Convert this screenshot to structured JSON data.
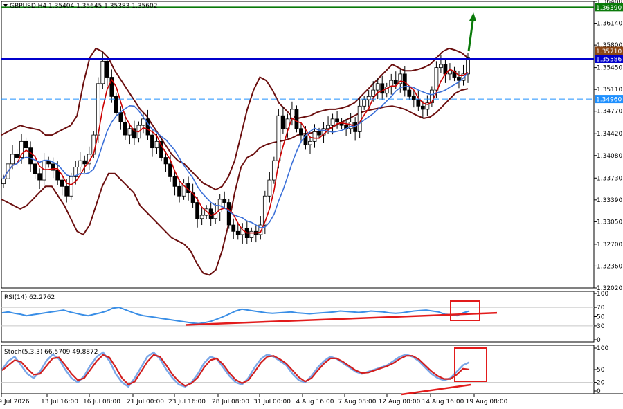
{
  "header": {
    "symbol": "GBPUSD,H4",
    "ohlc": "1.35404 1.35645 1.35383 1.35602"
  },
  "chart_data": [
    {
      "type": "candlestick",
      "name": "main",
      "ylim": [
        1.3202,
        1.3648
      ],
      "y_ticks": [
        "1.36480",
        "1.36140",
        "1.35800",
        "1.35450",
        "1.35110",
        "1.34770",
        "1.34420",
        "1.34080",
        "1.33730",
        "1.33390",
        "1.33050",
        "1.32700",
        "1.32360",
        "1.32020"
      ],
      "price_tags": [
        {
          "label": "1.36390",
          "value": 1.3639,
          "bg": "#0a7a0a",
          "fg": "#ffffff"
        },
        {
          "label": "1.35710",
          "value": 1.3571,
          "bg": "#8b4513",
          "fg": "#ffffff"
        },
        {
          "label": "1.35586",
          "value": 1.35586,
          "bg": "#0000cc",
          "fg": "#ffffff"
        },
        {
          "label": "1.34960",
          "value": 1.3496,
          "bg": "#1e90ff",
          "fg": "#ffffff"
        }
      ],
      "hlines": [
        {
          "value": 1.3639,
          "color": "#0a7a0a",
          "style": "solid",
          "width": 2
        },
        {
          "value": 1.3571,
          "color": "#8b4513",
          "style": "dashed",
          "width": 1
        },
        {
          "value": 1.35586,
          "color": "#0000cc",
          "style": "solid",
          "width": 2
        },
        {
          "value": 1.3496,
          "color": "#1e90ff",
          "style": "dashed",
          "width": 1
        }
      ],
      "closes": [
        1.3372,
        1.3395,
        1.341,
        1.3405,
        1.343,
        1.342,
        1.3395,
        1.338,
        1.337,
        1.34,
        1.3395,
        1.3385,
        1.337,
        1.336,
        1.3345,
        1.3375,
        1.339,
        1.34,
        1.3395,
        1.341,
        1.344,
        1.352,
        1.3555,
        1.353,
        1.35,
        1.3475,
        1.346,
        1.344,
        1.345,
        1.3435,
        1.3455,
        1.3465,
        1.344,
        1.342,
        1.343,
        1.3405,
        1.3395,
        1.3375,
        1.336,
        1.3345,
        1.3365,
        1.335,
        1.3335,
        1.331,
        1.3315,
        1.3325,
        1.331,
        1.332,
        1.334,
        1.3335,
        1.33,
        1.329,
        1.3285,
        1.3295,
        1.328,
        1.329,
        1.3285,
        1.33,
        1.3345,
        1.337,
        1.34,
        1.347,
        1.345,
        1.3465,
        1.348,
        1.345,
        1.344,
        1.3425,
        1.343,
        1.3445,
        1.344,
        1.345,
        1.3455,
        1.3465,
        1.346,
        1.3455,
        1.345,
        1.346,
        1.3445,
        1.3485,
        1.3495,
        1.35,
        1.351,
        1.352,
        1.3505,
        1.3515,
        1.3525,
        1.352,
        1.3535,
        1.351,
        1.35,
        1.3495,
        1.3485,
        1.348,
        1.349,
        1.351,
        1.3545,
        1.355,
        1.3535,
        1.354,
        1.353,
        1.3525,
        1.3535,
        1.356
      ],
      "bb_upper": [
        1.344,
        1.3445,
        1.345,
        1.3455,
        1.3452,
        1.345,
        1.3448,
        1.344,
        1.344,
        1.3445,
        1.345,
        1.3455,
        1.347,
        1.352,
        1.356,
        1.3575,
        1.357,
        1.356,
        1.354,
        1.3525,
        1.351,
        1.3495,
        1.348,
        1.347,
        1.3455,
        1.344,
        1.3425,
        1.341,
        1.34,
        1.3395,
        1.3385,
        1.3375,
        1.3365,
        1.336,
        1.3355,
        1.336,
        1.3375,
        1.34,
        1.344,
        1.348,
        1.351,
        1.353,
        1.3525,
        1.351,
        1.349,
        1.348,
        1.347,
        1.3466,
        1.3468,
        1.347,
        1.3475,
        1.3478,
        1.348,
        1.348,
        1.3482,
        1.3485,
        1.349,
        1.35,
        1.351,
        1.352,
        1.353,
        1.354,
        1.355,
        1.3545,
        1.354,
        1.354,
        1.3542,
        1.3545,
        1.355,
        1.356,
        1.357,
        1.3575,
        1.3572,
        1.3568,
        1.356
      ],
      "bb_lower": [
        1.334,
        1.3335,
        1.333,
        1.3325,
        1.333,
        1.334,
        1.335,
        1.336,
        1.336,
        1.3345,
        1.333,
        1.331,
        1.329,
        1.3285,
        1.33,
        1.333,
        1.336,
        1.338,
        1.338,
        1.337,
        1.336,
        1.335,
        1.333,
        1.332,
        1.331,
        1.33,
        1.329,
        1.328,
        1.3275,
        1.327,
        1.326,
        1.324,
        1.3225,
        1.3222,
        1.323,
        1.326,
        1.33,
        1.335,
        1.339,
        1.3405,
        1.341,
        1.342,
        1.3425,
        1.3428,
        1.343,
        1.3432,
        1.3435,
        1.344,
        1.3442,
        1.3443,
        1.3445,
        1.3448,
        1.345,
        1.3455,
        1.346,
        1.3465,
        1.347,
        1.3475,
        1.3478,
        1.348,
        1.3482,
        1.3484,
        1.3485,
        1.3483,
        1.348,
        1.3475,
        1.347,
        1.3466,
        1.3468,
        1.3475,
        1.3485,
        1.3495,
        1.3505,
        1.351,
        1.3512
      ]
    },
    {
      "type": "line",
      "name": "RSI(14)",
      "label": "RSI(14) 62.2762",
      "ylim": [
        0,
        100
      ],
      "y_ticks": [
        "100",
        "70",
        "50",
        "30",
        "0"
      ],
      "values": [
        58,
        60,
        57,
        55,
        52,
        54,
        56,
        58,
        60,
        62,
        64,
        60,
        57,
        54,
        52,
        55,
        58,
        62,
        68,
        70,
        65,
        60,
        55,
        52,
        50,
        48,
        46,
        44,
        42,
        40,
        38,
        36,
        35,
        37,
        40,
        45,
        50,
        56,
        62,
        66,
        64,
        62,
        60,
        58,
        57,
        58,
        59,
        60,
        58,
        57,
        56,
        57,
        58,
        59,
        60,
        62,
        61,
        60,
        59,
        60,
        62,
        61,
        60,
        58,
        57,
        58,
        60,
        62,
        63,
        64,
        62,
        60,
        55,
        54,
        52,
        58,
        62
      ],
      "trend_line": [
        [
          0.2,
          35
        ],
        [
          0.8,
          55
        ]
      ]
    },
    {
      "type": "line",
      "name": "Stoch(5,3,3)",
      "label": "Stoch(5,3,3) 66.5709 49.8872",
      "ylim": [
        0,
        100
      ],
      "y_ticks": [
        "100",
        "50",
        "20",
        "0"
      ],
      "main": [
        50,
        70,
        80,
        60,
        40,
        30,
        45,
        70,
        85,
        75,
        50,
        30,
        20,
        35,
        60,
        80,
        90,
        70,
        40,
        20,
        10,
        30,
        55,
        80,
        90,
        75,
        50,
        30,
        15,
        10,
        20,
        40,
        65,
        80,
        75,
        55,
        35,
        20,
        15,
        30,
        55,
        75,
        85,
        80,
        70,
        60,
        40,
        25,
        20,
        35,
        55,
        70,
        80,
        75,
        65,
        55,
        45,
        40,
        45,
        50,
        55,
        60,
        70,
        80,
        85,
        80,
        70,
        55,
        40,
        30,
        25,
        30,
        45,
        60,
        67
      ],
      "signal": [
        48,
        60,
        72,
        68,
        52,
        38,
        40,
        58,
        76,
        78,
        60,
        40,
        25,
        30,
        50,
        70,
        84,
        78,
        55,
        30,
        15,
        22,
        45,
        68,
        84,
        80,
        60,
        38,
        22,
        12,
        18,
        32,
        55,
        72,
        76,
        62,
        42,
        26,
        18,
        25,
        45,
        66,
        80,
        82,
        74,
        64,
        48,
        32,
        22,
        30,
        48,
        64,
        76,
        76,
        68,
        58,
        48,
        42,
        43,
        48,
        53,
        58,
        65,
        75,
        82,
        82,
        74,
        60,
        46,
        35,
        28,
        28,
        38,
        52,
        50
      ]
    }
  ],
  "x_labels": [
    "9 Jul 2026",
    "13 Jul 16:00",
    "16 Jul 08:00",
    "21 Jul 00:00",
    "23 Jul 16:00",
    "28 Jul 08:00",
    "31 Jul 00:00",
    "4 Aug 16:00",
    "7 Aug 08:00",
    "12 Aug 00:00",
    "14 Aug 16:00",
    "19 Aug 08:00"
  ],
  "colors": {
    "candle_up": "#0a7a0a",
    "candle_down": "#cc0000",
    "bollinger": "#6b0f0f",
    "ma_fast": "#cc0000",
    "ma_slow": "#3a6fd8",
    "rsi": "#3a8ee6",
    "stoch_main": "#7aa7e8",
    "stoch_signal": "#d21f1f",
    "annot": "#e21b1b",
    "arrow": "#0a7a0a"
  }
}
